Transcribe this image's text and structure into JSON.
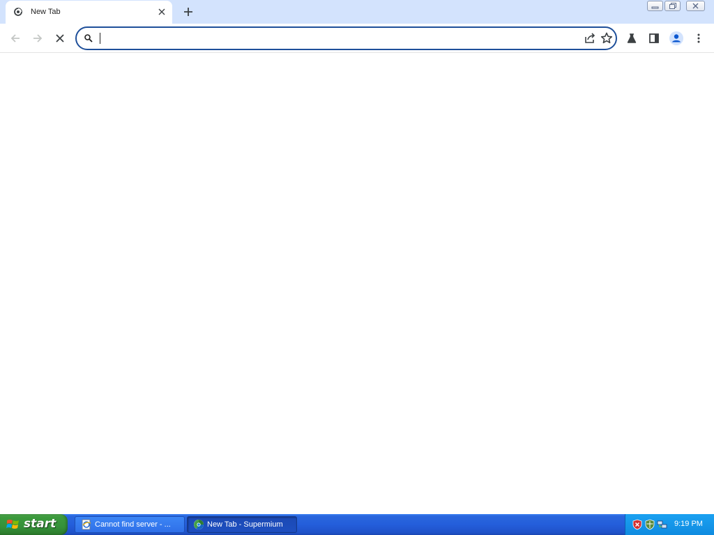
{
  "browser": {
    "tab": {
      "title": "New Tab"
    },
    "omnibox": {
      "value": "",
      "placeholder": ""
    }
  },
  "taskbar": {
    "start_label": "start",
    "tasks": [
      {
        "label": "Cannot find server - ...",
        "icon": "ie-page-icon"
      },
      {
        "label": "New Tab - Supermium",
        "icon": "supermium-icon"
      }
    ],
    "clock": "9:19 PM"
  },
  "colors": {
    "tab_strip": "#d3e3fd",
    "omnibox_focus": "#1e4f9a",
    "taskbar": "#245edb",
    "start_button": "#3c9a3c",
    "tray": "#1ba1f1"
  }
}
